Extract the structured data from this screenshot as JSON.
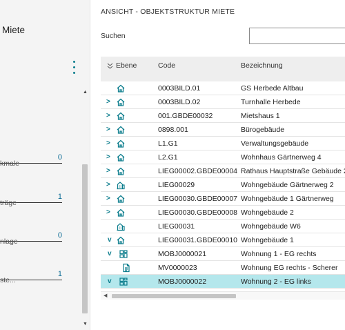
{
  "left_panel": {
    "title": "Miete",
    "stats": [
      {
        "value": "0",
        "label": "kmale"
      },
      {
        "value": "1",
        "label": "träge"
      },
      {
        "value": "0",
        "label": "nlage"
      },
      {
        "value": "1",
        "label": "ste..."
      }
    ]
  },
  "right_panel": {
    "heading": "ANSICHT - OBJEKTSTRUKTUR MIETE",
    "search": {
      "label": "Suchen",
      "value": "",
      "placeholder": ""
    },
    "columns": {
      "ebene": "Ebene",
      "code": "Code",
      "bezeichnung": "Bezeichnung"
    },
    "rows": [
      {
        "expander": "",
        "icon": "house-icon",
        "code": "0003BILD.01",
        "bez": "GS Herbede Altbau"
      },
      {
        "expander": ">",
        "icon": "house-icon",
        "code": "0003BILD.02",
        "bez": "Turnhalle Herbede"
      },
      {
        "expander": ">",
        "icon": "house-icon",
        "code": "001.GBDE00032",
        "bez": "Mietshaus 1"
      },
      {
        "expander": ">",
        "icon": "house-icon",
        "code": "0898.001",
        "bez": "Bürogebäude"
      },
      {
        "expander": ">",
        "icon": "house-icon",
        "code": "L1.G1",
        "bez": "Verwaltungsgebäude"
      },
      {
        "expander": ">",
        "icon": "house-icon",
        "code": "L2.G1",
        "bez": "Wohnhaus Gärtnerweg 4"
      },
      {
        "expander": ">",
        "icon": "house-icon",
        "code": "LIEG00002.GBDE00004",
        "bez": "Rathaus Hauptstraße Gebäude 2"
      },
      {
        "expander": ">",
        "icon": "building-icon",
        "code": "LIEG00029",
        "bez": "Wohngebäude Gärtnerweg 2"
      },
      {
        "expander": ">",
        "icon": "house-icon",
        "code": "LIEG00030.GBDE00007",
        "bez": "Wohngebäude 1 Gärtnerweg"
      },
      {
        "expander": ">",
        "icon": "house-icon",
        "code": "LIEG00030.GBDE00008",
        "bez": "Wohngebäude 2"
      },
      {
        "expander": "",
        "icon": "building-icon",
        "code": "LIEG00031",
        "bez": "Wohngebäude W6"
      },
      {
        "expander": "v",
        "icon": "house-icon",
        "code": "LIEG00031.GBDE00010",
        "bez": "Wohngebäude 1"
      },
      {
        "expander": "v",
        "icon": "unit-icon",
        "code": "MOBJ0000021",
        "bez": "Wohnung 1 - EG rechts"
      },
      {
        "expander": "",
        "icon": "document-icon",
        "code": "MV0000023",
        "bez": "Wohnung EG rechts - Scherer"
      },
      {
        "expander": "v",
        "icon": "unit-icon",
        "code": "MOBJ0000022",
        "bez": "Wohnung 2 - EG links",
        "selected": true
      }
    ]
  },
  "colors": {
    "accent": "#0a7c8c",
    "selected_row": "#b4e7ec"
  }
}
